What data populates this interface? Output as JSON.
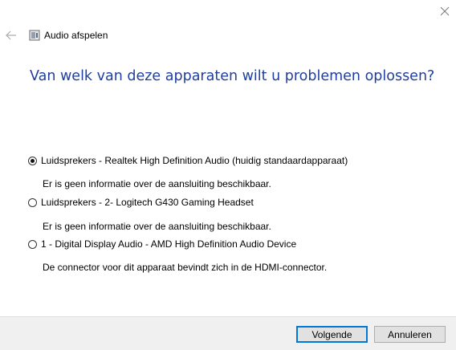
{
  "window": {
    "title": "Audio afspelen"
  },
  "icons": {
    "back": "back-arrow-icon",
    "close": "close-icon",
    "app": "audio-troubleshooter-icon"
  },
  "question": "Van welk van deze apparaten wilt u problemen oplossen?",
  "devices": [
    {
      "label": "Luidsprekers - Realtek High Definition Audio (huidig standaardapparaat)",
      "description": "Er is geen informatie over de aansluiting beschikbaar.",
      "selected": true
    },
    {
      "label": "Luidsprekers - 2- Logitech G430 Gaming Headset",
      "description": "Er is geen informatie over de aansluiting beschikbaar.",
      "selected": false
    },
    {
      "label": "1 - Digital Display Audio - AMD High Definition Audio Device",
      "description": "De connector voor dit apparaat bevindt zich in de HDMI-connector.",
      "selected": false
    }
  ],
  "footer": {
    "next_label": "Volgende",
    "cancel_label": "Annuleren"
  },
  "colors": {
    "title": "#1f3f9e",
    "footer_bg": "#f0f0f0",
    "primary_border": "#0078d7"
  }
}
